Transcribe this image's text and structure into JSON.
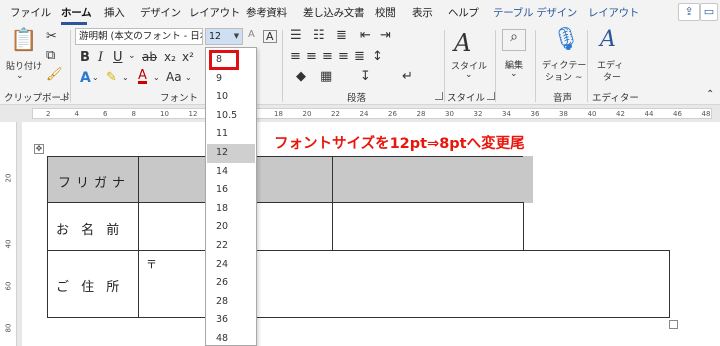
{
  "menu": {
    "tabs": [
      "ファイル",
      "ホーム",
      "挿入",
      "デザイン",
      "レイアウト",
      "参考資料",
      "差し込み文書",
      "校閲",
      "表示",
      "ヘルプ",
      "テーブル デザイン",
      "レイアウト"
    ],
    "active_index": 1
  },
  "ribbon": {
    "clipboard": {
      "paste_label": "貼り付け",
      "group_label": "クリップボード"
    },
    "font": {
      "font_name": "游明朝 (本文のフォント - 日本",
      "font_size": "12",
      "group_label": "フォント"
    },
    "paragraph": {
      "group_label": "段落"
    },
    "style": {
      "button_label": "スタイル",
      "group_label": "スタイル"
    },
    "edit": {
      "button_label": "編集"
    },
    "voice": {
      "button_label_1": "ディクテー",
      "button_label_2": "ション ~",
      "group_label": "音声"
    },
    "editor": {
      "button_label_1": "エディ",
      "button_label_2": "ター",
      "group_label": "エディター"
    }
  },
  "ruler": {
    "h_numbers": [
      "2",
      "4",
      "6",
      "8",
      "10",
      "12",
      "14",
      "16",
      "18",
      "20",
      "22",
      "24",
      "26",
      "28",
      "30",
      "32",
      "34",
      "36",
      "38",
      "40",
      "42",
      "44",
      "46",
      "48"
    ],
    "v_numbers": [
      "20",
      "40",
      "60",
      "80"
    ]
  },
  "font_size_dropdown": {
    "options": [
      "8",
      "9",
      "10",
      "10.5",
      "11",
      "12",
      "14",
      "16",
      "18",
      "20",
      "22",
      "24",
      "26",
      "28",
      "36",
      "48"
    ],
    "selected": "12",
    "highlighted": "8"
  },
  "document": {
    "annotation": "フォントサイズを12pt⇒8ptへ変更尾",
    "rows": [
      {
        "label": "フリガナ"
      },
      {
        "label": "お 名 前"
      },
      {
        "label": "ご 住 所",
        "value": "〒"
      }
    ]
  },
  "colors": {
    "accent": "#2b579a",
    "annotation": "#e8160c",
    "highlight_box": "#e01010"
  }
}
